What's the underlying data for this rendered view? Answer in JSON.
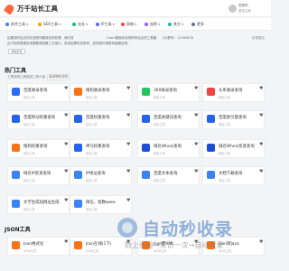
{
  "header": {
    "site_name": "万千站长工具",
    "user_greeting": "您您好，",
    "user_login": "登录注册"
  },
  "nav": [
    {
      "label": "综合工具",
      "color": "#3b82f6",
      "caret": true
    },
    {
      "label": "SEO工具",
      "color": "#f59e0b",
      "caret": true
    },
    {
      "label": "站长",
      "color": "#10b981",
      "caret": true
    },
    {
      "label": "IP工具",
      "color": "#6366f1",
      "caret": true
    },
    {
      "label": "网络",
      "color": "#ef4444",
      "caret": true
    },
    {
      "label": "加密",
      "color": "#8b5cf6",
      "caret": true
    },
    {
      "label": "其它",
      "color": "#14b8a6",
      "caret": true
    },
    {
      "label": "更多",
      "color": "#64748b",
      "caret": false
    }
  ],
  "notice": {
    "line1a": "如果您的站点存在违规问题请及时处理，我们将",
    "line1b": "Gram是面向全球所有站点的工具集合，",
    "line1c": "QQ群号：12345678",
    "line2": "由于相关数据查询需要调用第三方接口，查询结果仅供参考，如有疑问请联系客服反馈。",
    "quick_button": "快速反馈",
    "right": "反馈建议"
  },
  "hot_section": {
    "title": "热门工具",
    "subtitle": "工具说明工具描述工具介绍",
    "tag": "使用帮助说明"
  },
  "tools": [
    {
      "title": "百度收录查询",
      "meta": "综合工具",
      "color": "#2b6cf6"
    },
    {
      "title": "搜狗收录查询",
      "meta": "综合工具",
      "color": "#f97316"
    },
    {
      "title": "360收录查询",
      "meta": "综合工具",
      "color": "#22c55e"
    },
    {
      "title": "头条收录查询",
      "meta": "综合工具",
      "color": "#ef4444"
    },
    {
      "title": "百度移动权重查询",
      "meta": "综合工具",
      "color": "#2563eb"
    },
    {
      "title": "百度权重查询",
      "meta": "综合工具",
      "color": "#2563eb"
    },
    {
      "title": "百度关键词查询",
      "meta": "综合工具",
      "color": "#2563eb"
    },
    {
      "title": "百度索引量查询",
      "meta": "综合工具",
      "color": "#2563eb"
    },
    {
      "title": "搜狗权重查询",
      "meta": "综合工具",
      "color": "#f97316"
    },
    {
      "title": "神马权重查询",
      "meta": "综合工具",
      "color": "#2563eb"
    },
    {
      "title": "域名Whois查询",
      "meta": "综合工具",
      "color": "#1d4ed8"
    },
    {
      "title": "域名Whois反查查询",
      "meta": "综合工具",
      "color": "#1d4ed8"
    },
    {
      "title": "域名IP反查查询",
      "meta": "综合工具",
      "color": "#3b82f6"
    },
    {
      "title": "IP地址查询",
      "meta": "综合工具",
      "color": "#3b82f6"
    },
    {
      "title": "百度文本查询",
      "meta": "综合工具",
      "color": "#3b82f6"
    },
    {
      "title": "文档下载查询",
      "meta": "综合工具",
      "color": "#3b82f6"
    },
    {
      "title": "文字生成短网址生成",
      "meta": "综合工具",
      "color": "#3b82f6"
    },
    {
      "title": "微信、指数www",
      "meta": "综合工具",
      "color": "#3b82f6"
    }
  ],
  "json_section": {
    "title": "JSON工具"
  },
  "json_tools": [
    {
      "title": "Json格式化",
      "meta": "JSON工具",
      "color": "#f97316"
    },
    {
      "title": "Json在线(1下)",
      "meta": "JSON工具",
      "color": "#f97316"
    },
    {
      "title": "Json转XML",
      "meta": "JSON工具",
      "color": "#f97316"
    },
    {
      "title": "Json转Java",
      "meta": "JSON工具",
      "color": "#f97316"
    }
  ],
  "watermark": {
    "main": "自动秒收录",
    "sub": "数上线接→来访一次→自动收录"
  },
  "icons": {
    "favorite": "heart-icon",
    "logo": "rocket-icon"
  }
}
